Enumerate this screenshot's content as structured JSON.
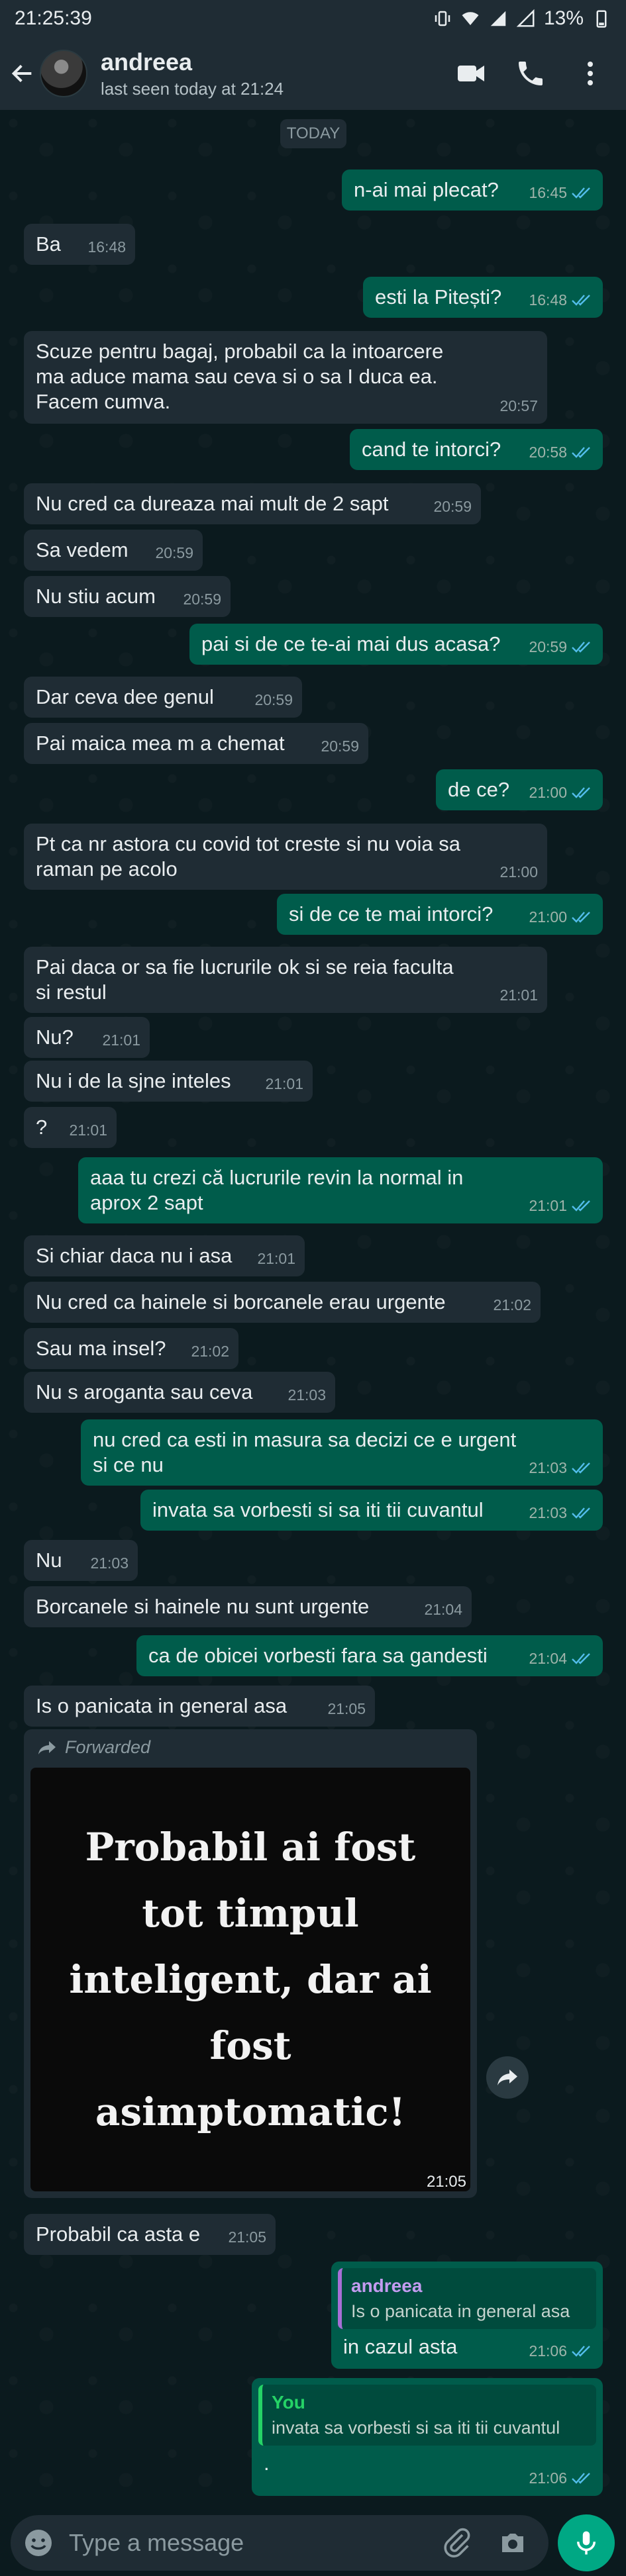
{
  "statusbar": {
    "time": "21:25:39",
    "battery": "13%"
  },
  "header": {
    "name": "andreea",
    "last_seen": "last seen today at 21:24"
  },
  "date_chip": "TODAY",
  "messages": [
    {
      "dir": "out",
      "text": "n-ai mai plecat?",
      "time": "16:45"
    },
    {
      "dir": "in",
      "text": "Ba",
      "time": "16:48"
    },
    {
      "dir": "out",
      "text": "esti la Pitești?",
      "time": "16:48"
    },
    {
      "dir": "in",
      "text": "Scuze pentru bagaj, probabil ca la intoarcere ma aduce mama sau ceva si o sa I duca ea. Facem cumva.",
      "time": "20:57"
    },
    {
      "dir": "out",
      "text": "cand te intorci?",
      "time": "20:58"
    },
    {
      "dir": "in",
      "text": "Nu cred ca dureaza mai mult de 2 sapt",
      "time": "20:59"
    },
    {
      "dir": "in",
      "text": "Sa vedem",
      "time": "20:59"
    },
    {
      "dir": "in",
      "text": "Nu stiu acum",
      "time": "20:59"
    },
    {
      "dir": "out",
      "text": "pai si de ce te-ai mai dus acasa?",
      "time": "20:59"
    },
    {
      "dir": "in",
      "text": "Dar ceva dee genul",
      "time": "20:59"
    },
    {
      "dir": "in",
      "text": "Pai maica mea m a chemat",
      "time": "20:59"
    },
    {
      "dir": "out",
      "text": "de ce?",
      "time": "21:00"
    },
    {
      "dir": "in",
      "text": "Pt ca nr astora cu covid tot creste si nu voia sa raman pe acolo",
      "time": "21:00"
    },
    {
      "dir": "out",
      "text": "si de ce te mai intorci?",
      "time": "21:00"
    },
    {
      "dir": "in",
      "text": "Pai daca or sa fie lucrurile ok si se reia faculta si restul",
      "time": "21:01"
    },
    {
      "dir": "in",
      "text": "Nu?",
      "time": "21:01"
    },
    {
      "dir": "in",
      "text": "Nu i de la sjne inteles",
      "time": "21:01"
    },
    {
      "dir": "in",
      "text": "?",
      "time": "21:01"
    },
    {
      "dir": "out",
      "text": "aaa tu crezi că lucrurile revin la normal in aprox 2 sapt",
      "time": "21:01"
    },
    {
      "dir": "in",
      "text": "Si chiar daca nu i asa",
      "time": "21:01"
    },
    {
      "dir": "in",
      "text": "Nu cred ca hainele si borcanele erau urgente",
      "time": "21:02"
    },
    {
      "dir": "in",
      "text": "Sau ma insel?",
      "time": "21:02"
    },
    {
      "dir": "in",
      "text": "Nu s aroganta sau ceva",
      "time": "21:03"
    },
    {
      "dir": "out",
      "text": "nu cred ca esti in masura sa decizi ce e urgent si ce nu",
      "time": "21:03"
    },
    {
      "dir": "out",
      "text": "invata sa vorbesti si sa iti tii cuvantul",
      "time": "21:03"
    },
    {
      "dir": "in",
      "text": "Nu",
      "time": "21:03"
    },
    {
      "dir": "in",
      "text": "Borcanele si hainele nu sunt urgente",
      "time": "21:04"
    },
    {
      "dir": "out",
      "text": "ca de obicei vorbesti fara sa gandesti",
      "time": "21:04"
    },
    {
      "dir": "in",
      "text": "Is o panicata in general asa",
      "time": "21:05"
    },
    {
      "dir": "in",
      "text": "Probabil ca asta e",
      "time": "21:05"
    },
    {
      "dir": "out",
      "text": "in cazul asta",
      "time": "21:06"
    },
    {
      "dir": "out",
      "text": ".",
      "time": "21:06"
    }
  ],
  "forwarded": {
    "label": "Forwarded",
    "image_text": "Probabil ai fost tot timpul inteligent, dar ai fost asimptomatic!",
    "time": "21:05"
  },
  "quotes": {
    "q1": {
      "name": "andreea",
      "text": "Is o panicata in general asa"
    },
    "q2": {
      "name": "You",
      "text": "invata sa vorbesti si sa iti tii cuvantul"
    }
  },
  "input": {
    "placeholder": "Type a message"
  },
  "colors": {
    "incoming": "#1f2c34",
    "outgoing": "#005c4b",
    "accent": "#00a884",
    "ticks": "#53bdeb"
  }
}
